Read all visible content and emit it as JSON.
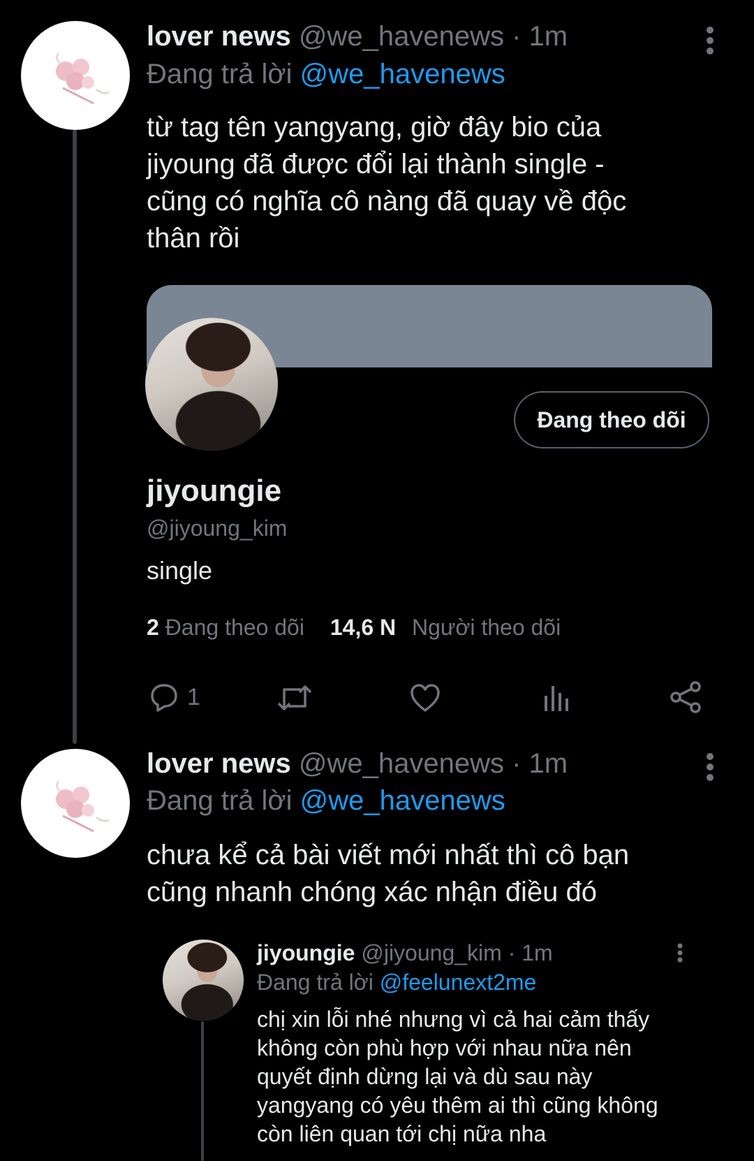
{
  "tweets": [
    {
      "display_name": "lover news",
      "handle": "@we_havenews · 1m",
      "reply_prefix": "Đang trả lời",
      "reply_to": "@we_havenews",
      "text_lines": [
        "từ tag tên yangyang, giờ đây bio của",
        "jiyoung đã được đổi lại thành single -",
        "cũng có nghĩa cô nàng đã quay về độc",
        "thân rồi"
      ],
      "profile_card": {
        "follow_button": "Đang theo dõi",
        "display_name": "jiyoungie",
        "handle": "@jiyoung_kim",
        "bio": "single",
        "following_count": "2",
        "following_label": "Đang theo dõi",
        "followers_count": "14,6 N",
        "followers_label": "Người theo dõi"
      },
      "actions": {
        "reply_count": "1"
      }
    },
    {
      "display_name": "lover news",
      "handle": "@we_havenews · 1m",
      "reply_prefix": "Đang trả lời",
      "reply_to": "@we_havenews",
      "text_lines": [
        "chưa kể cả bài viết mới nhất thì cô bạn",
        "cũng nhanh chóng xác nhận điều đó"
      ],
      "quoted": {
        "display_name": "jiyoungie",
        "handle": "@jiyoung_kim · 1m",
        "reply_prefix": "Đang trả lời",
        "reply_to": "@feelunext2me",
        "text_lines": [
          "chị xin lỗi nhé nhưng vì cả hai cảm thấy",
          "không còn phù hợp với nhau nữa nên",
          "quyết định dừng lại và dù sau này",
          "yangyang có yêu thêm ai thì cũng không",
          "còn liên quan tới chị nữa nha"
        ]
      }
    }
  ],
  "colors": {
    "background": "#000000",
    "text": "#e7e9ea",
    "muted": "#71767b",
    "link": "#1d9bf0",
    "banner": "#7b8694"
  },
  "icons": [
    "more-icon",
    "reply-icon",
    "retweet-icon",
    "like-icon",
    "analytics-icon",
    "share-icon",
    "flower-logo-icon"
  ]
}
